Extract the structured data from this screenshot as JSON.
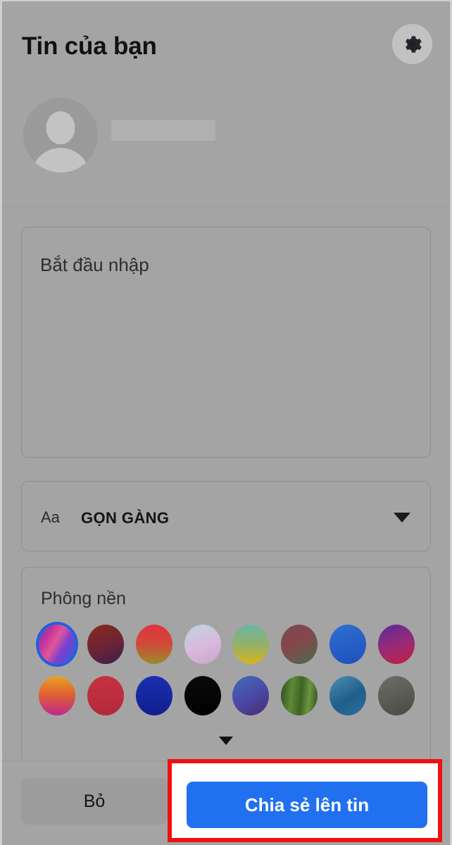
{
  "header": {
    "title": "Tin của bạn",
    "settings_icon": "gear-icon",
    "avatar_icon": "default-avatar-icon",
    "username_redacted": ""
  },
  "composer": {
    "placeholder": "Bắt đầu nhập",
    "value": ""
  },
  "text_style": {
    "aa_label": "Aa",
    "selected_style": "GỌN GÀNG",
    "caret_icon": "chevron-down-icon"
  },
  "background": {
    "title": "Phông nền",
    "expand_icon": "chevron-down-icon",
    "selected_index": 0,
    "swatches": [
      {
        "name": "swatch-pink-blue-swirl",
        "css": "linear-gradient(120deg,#3a46d8 0%,#c0339b 25%,#e0569a 45%,#7a3fd0 65%,#2b5fd9 100%)"
      },
      {
        "name": "swatch-dark-red-purple",
        "css": "linear-gradient(160deg,#8a2a16 0%,#6b2438 55%,#3a2047 100%)"
      },
      {
        "name": "swatch-red-olive",
        "css": "linear-gradient(180deg,#e0343c 0%,#d4473a 45%,#9a8a2a 100%)"
      },
      {
        "name": "swatch-lavender-teal",
        "css": "linear-gradient(160deg,#bcd7e2 0%,#d9b8dc 55%,#caa6cf 100%)"
      },
      {
        "name": "swatch-teal-yellow",
        "css": "linear-gradient(180deg,#6bb6a3 0%,#93b06a 50%,#d6b41c 100%)"
      },
      {
        "name": "swatch-mauve-green",
        "css": "linear-gradient(150deg,#7a4a52 0%,#86454c 40%,#4d6b4a 100%)"
      },
      {
        "name": "swatch-blue",
        "css": "linear-gradient(160deg,#2f6fd0 0%,#1f50bb 100%)"
      },
      {
        "name": "swatch-purple-crimson",
        "css": "linear-gradient(160deg,#5c2a9e 0%,#9b2a72 55%,#c21f44 100%)"
      },
      {
        "name": "swatch-orange-magenta",
        "css": "linear-gradient(180deg,#e8a327 0%,#e0622f 45%,#bf2a8e 100%)"
      },
      {
        "name": "swatch-crimson",
        "css": "linear-gradient(180deg,#c7313f 0%,#b22a3c 100%)"
      },
      {
        "name": "swatch-deep-blue",
        "css": "linear-gradient(180deg,#1a2fb0 0%,#111f8e 100%)"
      },
      {
        "name": "swatch-black",
        "css": "linear-gradient(180deg,#0a0a0a 0%,#000000 100%)"
      },
      {
        "name": "swatch-blue-purple",
        "css": "linear-gradient(150deg,#3f6fb5 0%,#4a4aa8 50%,#4b2a70 100%)"
      },
      {
        "name": "swatch-green-texture",
        "css": "linear-gradient(95deg,#2f4d1f 0%,#5f8a36 30%,#3d6323 55%,#6b9640 75%,#33521f 100%)"
      },
      {
        "name": "swatch-teal-blue",
        "css": "linear-gradient(150deg,#4e8fb0 0%,#1f5f8c 55%,#2b6f9c 100%)"
      },
      {
        "name": "swatch-dark-gray",
        "css": "linear-gradient(160deg,#6e6e68 0%,#4a4a45 100%)"
      }
    ]
  },
  "actions": {
    "discard_label": "Bỏ",
    "share_label": "Chia sẻ lên tin",
    "share_accent": "#2170ef",
    "highlight_color": "#ee1111"
  }
}
